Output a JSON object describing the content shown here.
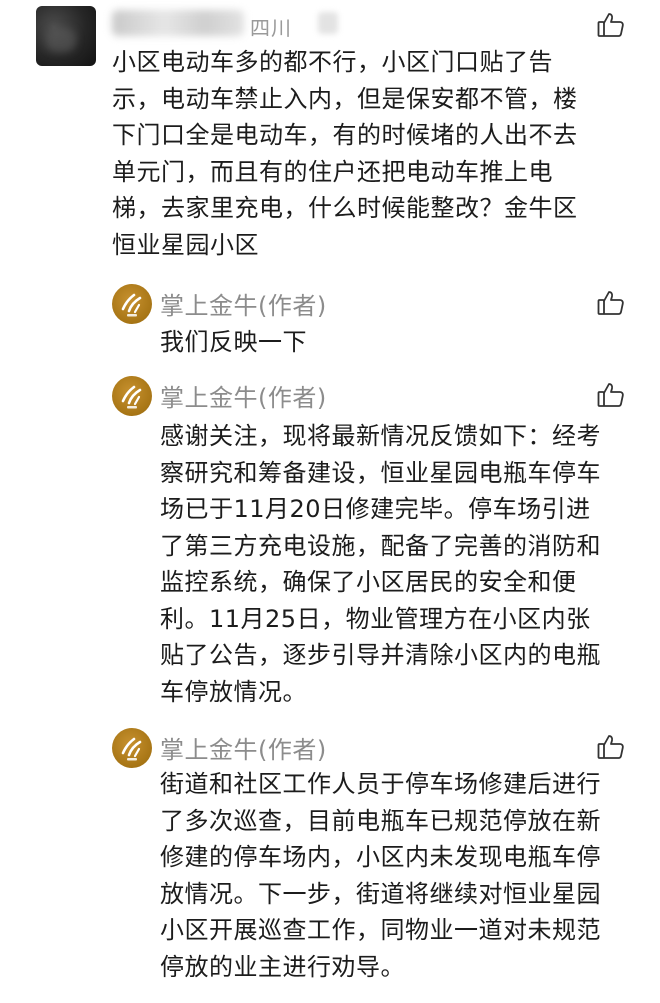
{
  "main_comment": {
    "location": "四川",
    "text_lines": [
      "小区电动车多的都不行，小区门口贴了告",
      "示，电动车禁止入内，但是保安都不管，楼",
      "下门口全是电动车，有的时候堵的人出不去",
      "单元门，而且有的住户还把电动车推上电",
      "梯，去家里充电，什么时候能整改？金牛区",
      "恒业星园小区"
    ]
  },
  "replies": [
    {
      "author": "掌上金牛(作者)",
      "text_lines": [
        "我们反映一下"
      ]
    },
    {
      "author": "掌上金牛(作者)",
      "text_lines": [
        "感谢关注，现将最新情况反馈如下：经考",
        "察研究和筹备建设，恒业星园电瓶车停车",
        "场已于11月20日修建完毕。停车场引进",
        "了第三方充电设施，配备了完善的消防和",
        "监控系统，确保了小区居民的安全和便",
        "利。11月25日，物业管理方在小区内张",
        "贴了公告，逐步引导并清除小区内的电瓶",
        "车停放情况。"
      ]
    },
    {
      "author": "掌上金牛(作者)",
      "text_lines": [
        "街道和社区工作人员于停车场修建后进行",
        "了多次巡查，目前电瓶车已规范停放在新",
        "修建的停车场内，小区内未发现电瓶车停",
        "放情况。下一步，街道将继续对恒业星园",
        "小区开展巡查工作，同物业一道对未规范",
        "停放的业主进行劝导。"
      ]
    }
  ],
  "icons": {
    "like": "thumbs-up-icon",
    "reply_avatar": "jinniu-logo-icon"
  },
  "colors": {
    "text": "#1c1c1c",
    "meta": "#8c8c8c",
    "avatar_gold": "#b07d1c"
  }
}
